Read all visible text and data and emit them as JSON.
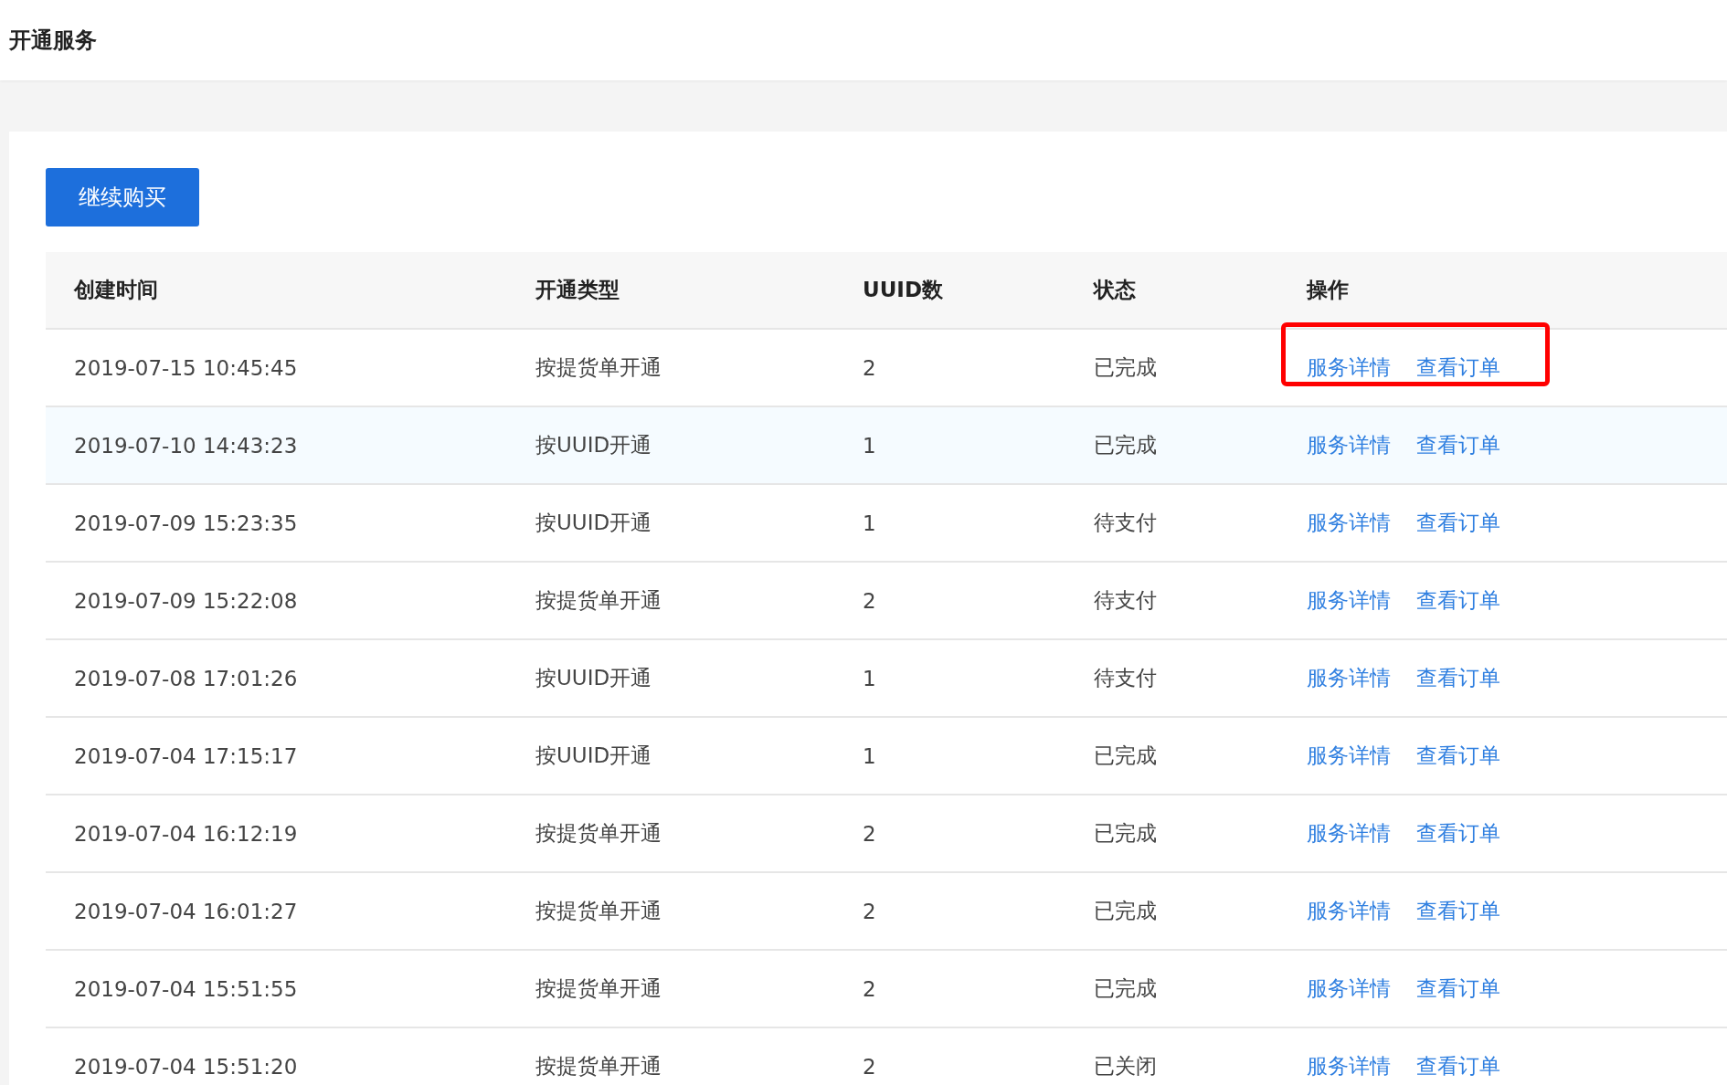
{
  "header": {
    "title": "开通服务"
  },
  "buy_button": "继续购买",
  "table": {
    "columns": [
      "创建时间",
      "开通类型",
      "UUID数",
      "状态",
      "操作"
    ],
    "rows": [
      {
        "created": "2019-07-15 10:45:45",
        "type": "按提货单开通",
        "uuid_count": "2",
        "status": "已完成",
        "actions": [
          "服务详情",
          "查看订单"
        ],
        "highlighted": false,
        "outlined": true
      },
      {
        "created": "2019-07-10 14:43:23",
        "type": "按UUID开通",
        "uuid_count": "1",
        "status": "已完成",
        "actions": [
          "服务详情",
          "查看订单"
        ],
        "highlighted": true,
        "outlined": false
      },
      {
        "created": "2019-07-09 15:23:35",
        "type": "按UUID开通",
        "uuid_count": "1",
        "status": "待支付",
        "actions": [
          "服务详情",
          "查看订单"
        ],
        "highlighted": false,
        "outlined": false
      },
      {
        "created": "2019-07-09 15:22:08",
        "type": "按提货单开通",
        "uuid_count": "2",
        "status": "待支付",
        "actions": [
          "服务详情",
          "查看订单"
        ],
        "highlighted": false,
        "outlined": false
      },
      {
        "created": "2019-07-08 17:01:26",
        "type": "按UUID开通",
        "uuid_count": "1",
        "status": "待支付",
        "actions": [
          "服务详情",
          "查看订单"
        ],
        "highlighted": false,
        "outlined": false
      },
      {
        "created": "2019-07-04 17:15:17",
        "type": "按UUID开通",
        "uuid_count": "1",
        "status": "已完成",
        "actions": [
          "服务详情",
          "查看订单"
        ],
        "highlighted": false,
        "outlined": false
      },
      {
        "created": "2019-07-04 16:12:19",
        "type": "按提货单开通",
        "uuid_count": "2",
        "status": "已完成",
        "actions": [
          "服务详情",
          "查看订单"
        ],
        "highlighted": false,
        "outlined": false
      },
      {
        "created": "2019-07-04 16:01:27",
        "type": "按提货单开通",
        "uuid_count": "2",
        "status": "已完成",
        "actions": [
          "服务详情",
          "查看订单"
        ],
        "highlighted": false,
        "outlined": false
      },
      {
        "created": "2019-07-04 15:51:55",
        "type": "按提货单开通",
        "uuid_count": "2",
        "status": "已完成",
        "actions": [
          "服务详情",
          "查看订单"
        ],
        "highlighted": false,
        "outlined": false
      },
      {
        "created": "2019-07-04 15:51:20",
        "type": "按提货单开通",
        "uuid_count": "2",
        "status": "已关闭",
        "actions": [
          "服务详情",
          "查看订单"
        ],
        "highlighted": false,
        "outlined": false
      }
    ]
  }
}
